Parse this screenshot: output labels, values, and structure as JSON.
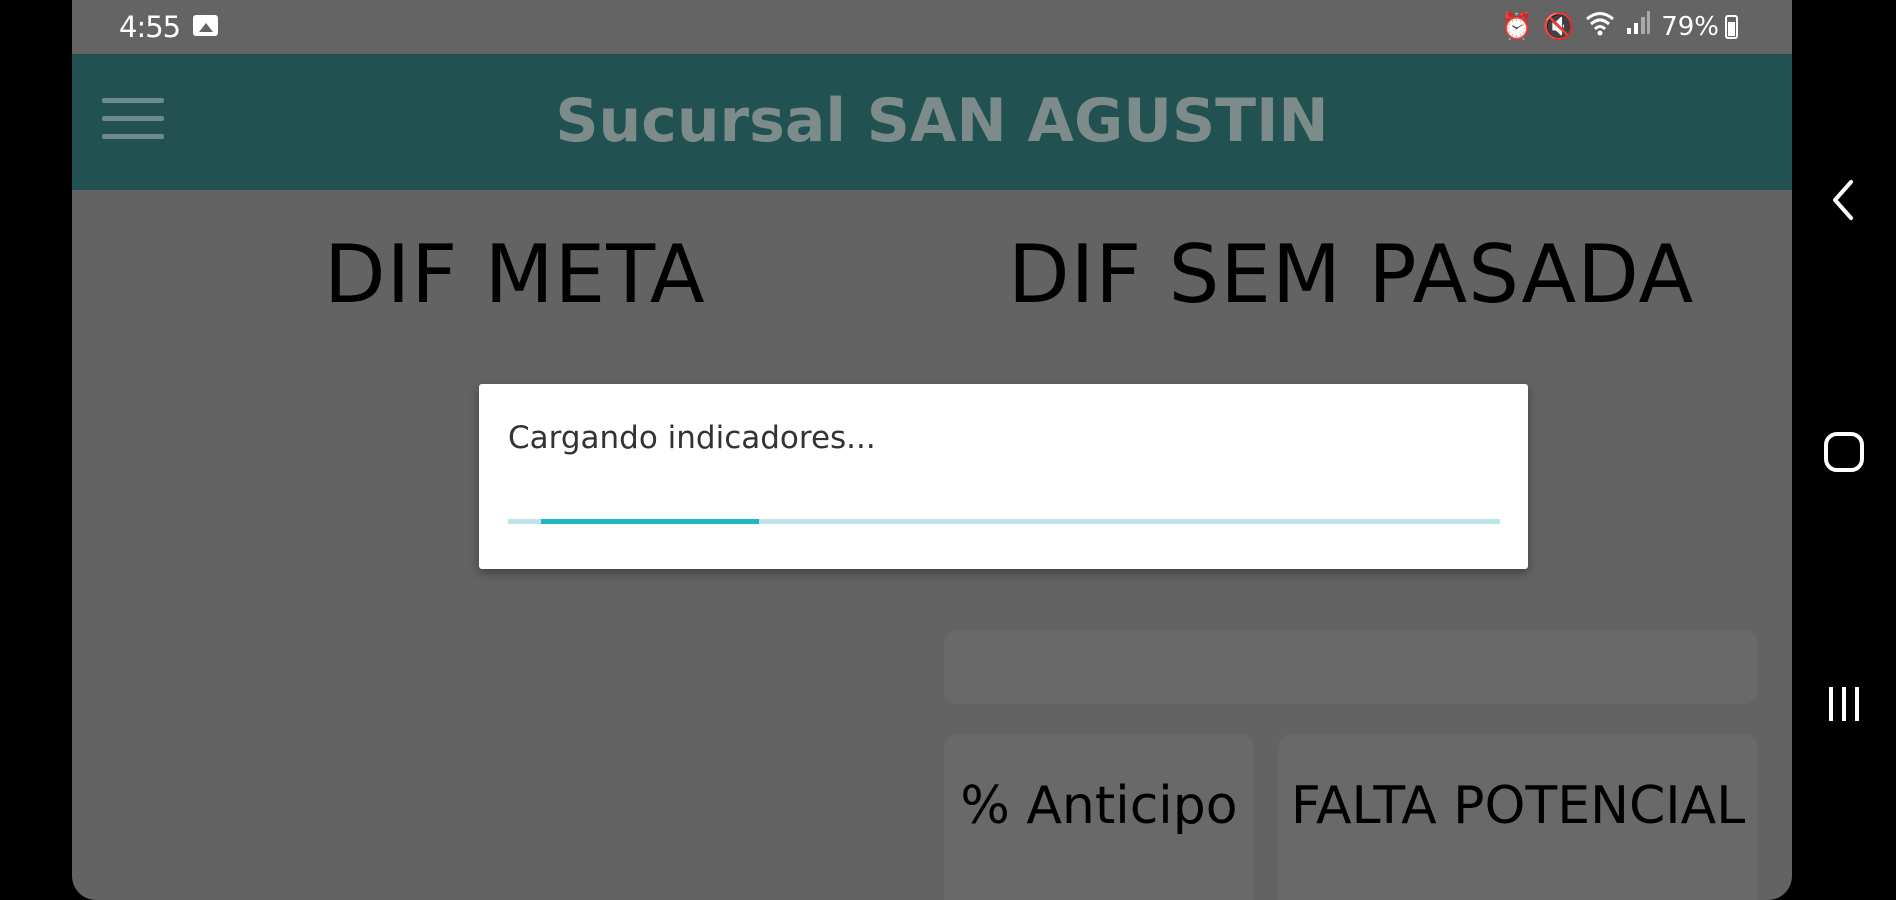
{
  "status_bar": {
    "time": "4:55",
    "icons": [
      "gallery-icon",
      "alarm-icon",
      "mute-icon",
      "wifi-icon",
      "signal-icon"
    ],
    "battery": "79%"
  },
  "app_bar": {
    "title": "Sucursal SAN AGUSTIN",
    "background": "#225152",
    "title_color": "#7d8c8b"
  },
  "main": {
    "heading_meta": "DIF META",
    "heading_sem": "DIF SEM PASADA",
    "card_anticipo": "% Anticipo",
    "card_falta": "FALTA POTENCIAL"
  },
  "dialog": {
    "message": "Cargando indicadores...",
    "progress": 0.22,
    "progress_color": "#20b7c4",
    "track_color": "#bde5e9"
  },
  "nav_bar": {
    "buttons": [
      "back-icon",
      "home-icon",
      "recent-apps-icon"
    ]
  }
}
